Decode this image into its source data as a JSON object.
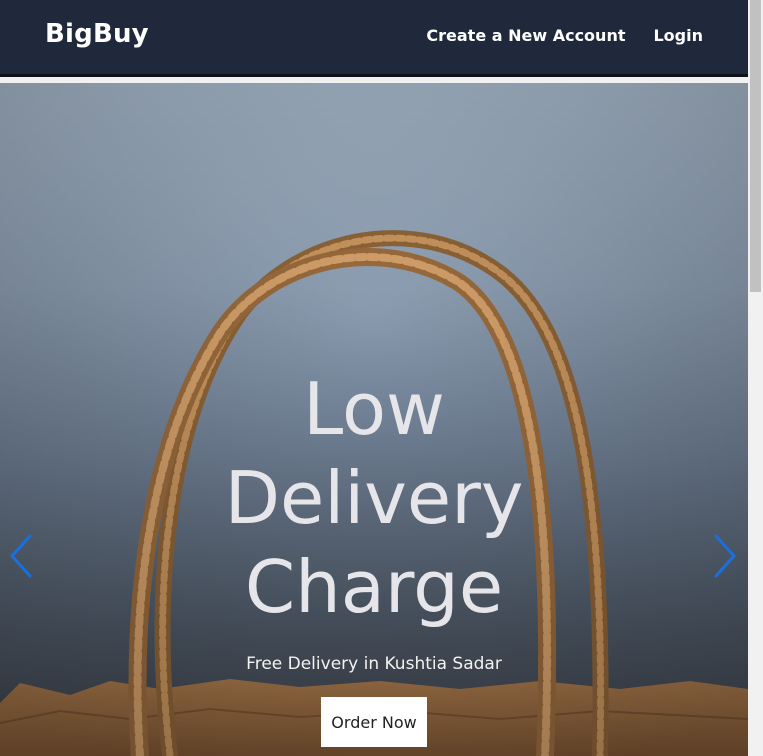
{
  "navbar": {
    "brand": "BigBuy",
    "links": [
      {
        "label": "Create a New Account"
      },
      {
        "label": "Login"
      }
    ],
    "background": "#1f293b"
  },
  "hero": {
    "title_lines": [
      "Low",
      "Delivery",
      "Charge"
    ],
    "subtitle": "Free Delivery in Kushtia Sadar",
    "cta_label": "Order Now",
    "arrows": {
      "prev": "chevron-left-icon",
      "next": "chevron-right-icon",
      "color": "#1a6fe0"
    },
    "image": "paper-shopping-bag"
  },
  "scrollbar": {
    "visible": true
  }
}
